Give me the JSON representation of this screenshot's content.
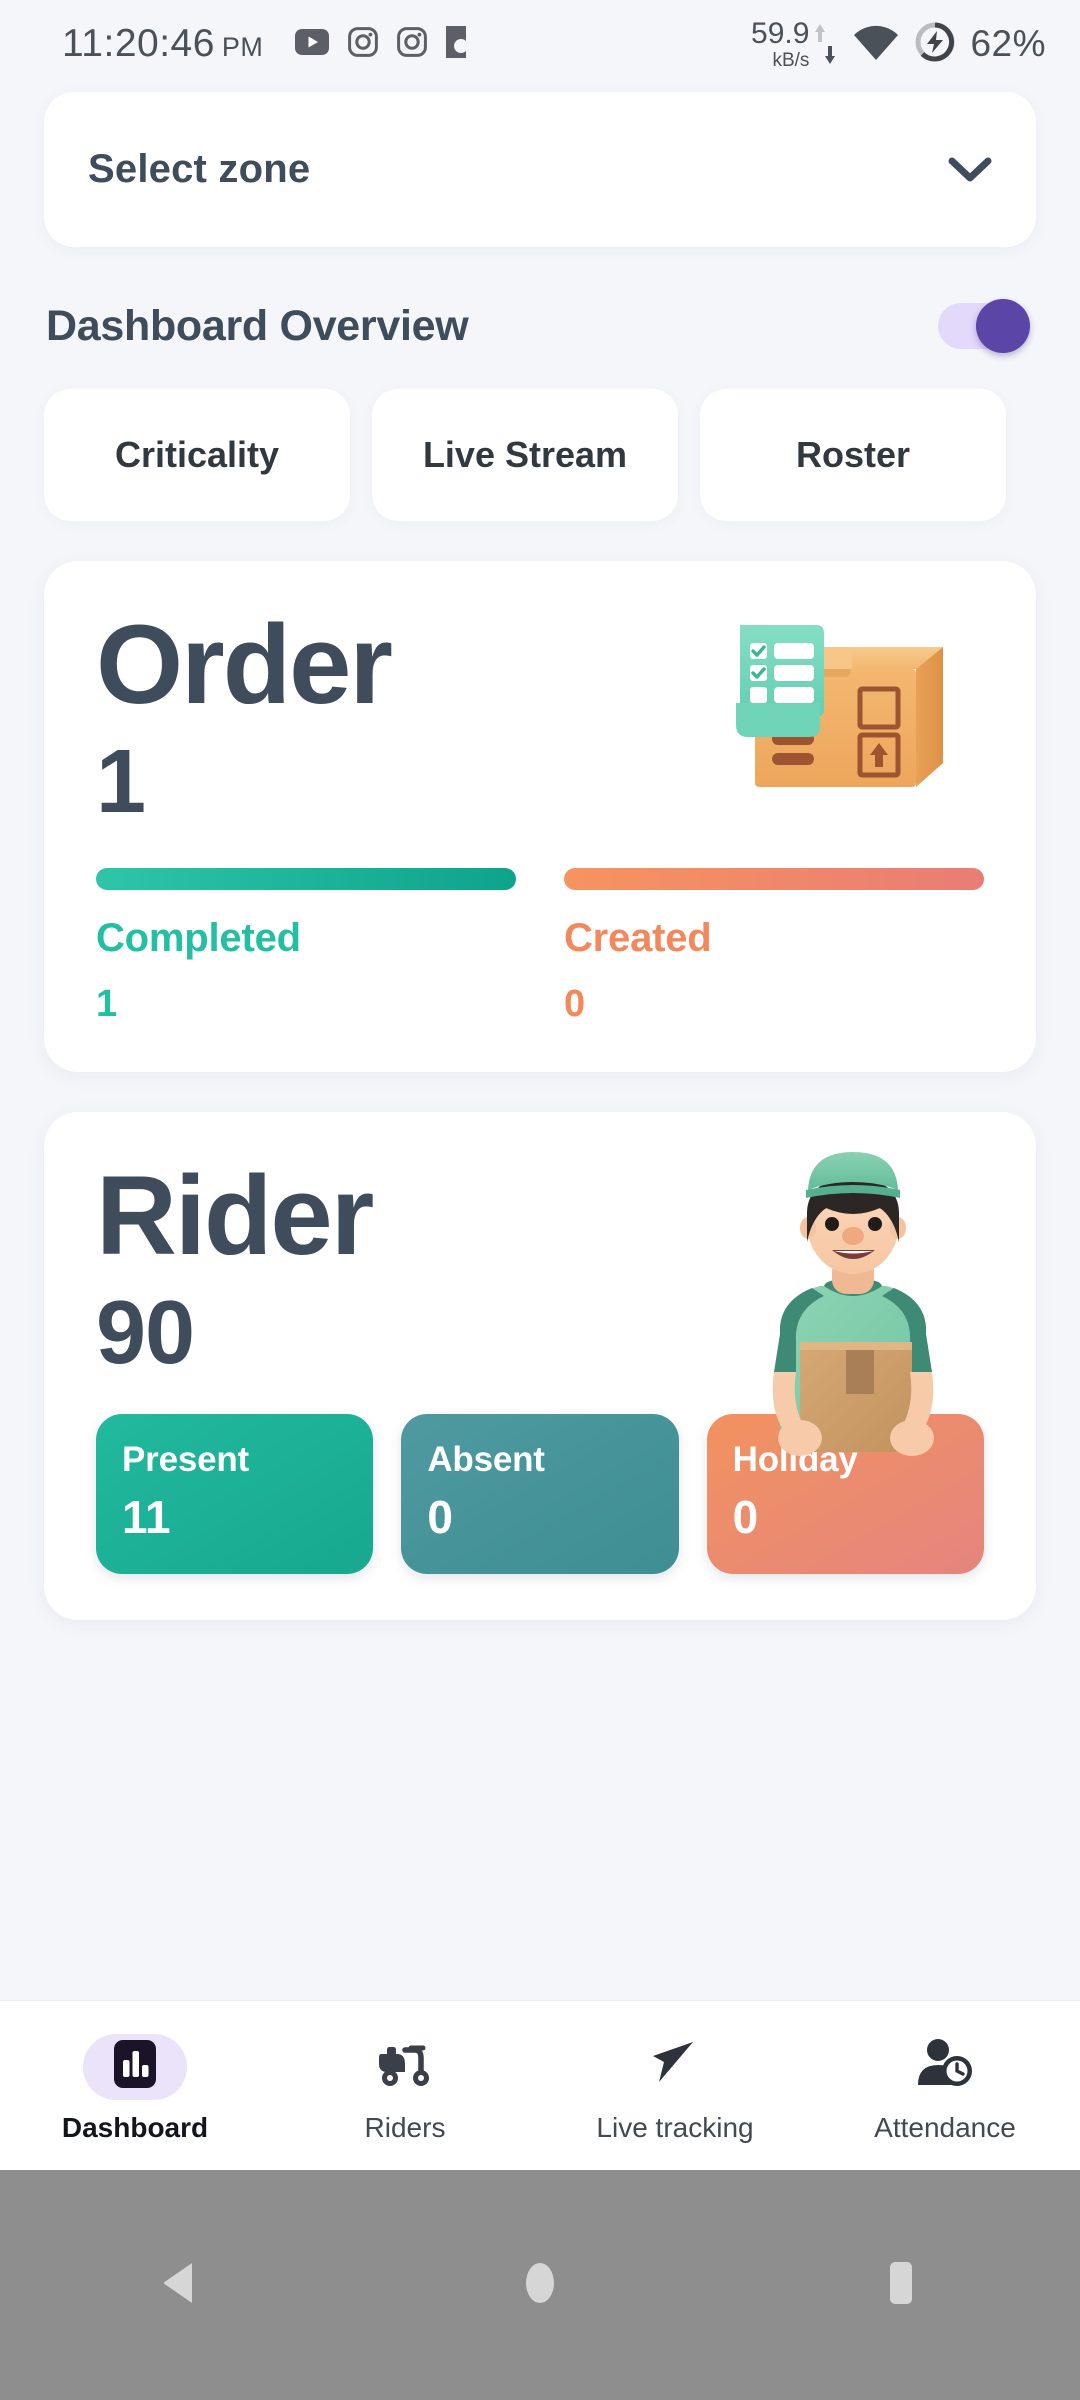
{
  "status_bar": {
    "time": "11:20:46",
    "meridiem": "PM",
    "left_icons": [
      "youtube-icon",
      "instagram-icon",
      "instagram-icon",
      "app-icon"
    ],
    "network_rate": "59.9",
    "network_unit": "kB/s",
    "wifi": "wifi-icon",
    "battery_saver": "battery-charging-icon",
    "battery_percent": "62%"
  },
  "zone": {
    "label": "Select zone",
    "chevron": "chevron-down-icon"
  },
  "dashboard": {
    "title": "Dashboard Overview",
    "toggle_on": true,
    "toggle_color": "#5B45A6",
    "toggle_track_color": "#E3D9FB"
  },
  "tabs": [
    {
      "label": "Criticality"
    },
    {
      "label": "Live Stream"
    },
    {
      "label": "Roster"
    }
  ],
  "order_card": {
    "title": "Order",
    "total": "1",
    "illustration": "package-box-checklist-icon",
    "stats": [
      {
        "label": "Completed",
        "value": "1",
        "color": "#22BFA3",
        "bar_fill": 100
      },
      {
        "label": "Created",
        "value": "0",
        "color": "#F2885C",
        "bar_fill": 100
      }
    ]
  },
  "rider_card": {
    "title": "Rider",
    "total": "90",
    "illustration": "delivery-rider-icon",
    "chips": [
      {
        "label": "Present",
        "value": "11",
        "color": "#17A88F"
      },
      {
        "label": "Absent",
        "value": "0",
        "color": "#3E8E94"
      },
      {
        "label": "Holiday",
        "value": "0",
        "color": "#E4857F"
      }
    ]
  },
  "bottom_nav": {
    "active_index": 0,
    "items": [
      {
        "label": "Dashboard",
        "icon": "bar-chart-icon"
      },
      {
        "label": "Riders",
        "icon": "scooter-icon"
      },
      {
        "label": "Live tracking",
        "icon": "navigation-arrow-icon"
      },
      {
        "label": "Attendance",
        "icon": "person-clock-icon"
      }
    ]
  },
  "system_nav": {
    "back": "back-triangle-icon",
    "home": "home-circle-icon",
    "recents": "recents-square-icon"
  }
}
